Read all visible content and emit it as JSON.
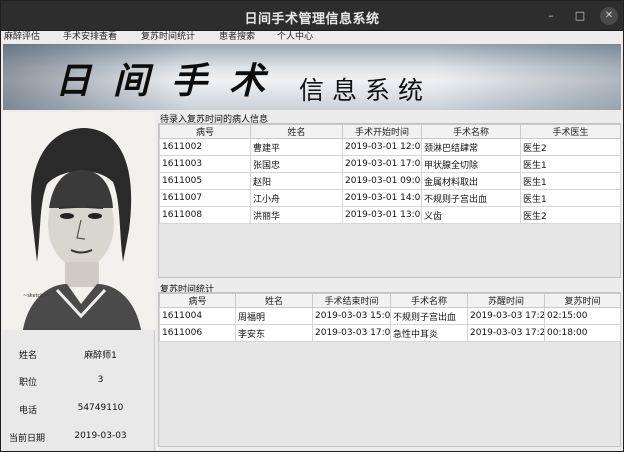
{
  "window": {
    "title": "日间手术管理信息系统"
  },
  "window_controls": {
    "minimize": "–",
    "maximize": "□",
    "close": "✕"
  },
  "menu": [
    "麻醉评估",
    "手术安排查看",
    "复苏时间统计",
    "患者搜索",
    "个人中心"
  ],
  "banner": {
    "calligraphy": "日间手术",
    "subtitle": "信息系统"
  },
  "profile": {
    "fields": [
      {
        "label": "姓名",
        "value": "麻醉师1"
      },
      {
        "label": "职位",
        "value": "3"
      },
      {
        "label": "电话",
        "value": "54749110"
      },
      {
        "label": "当前日期",
        "value": "2019-03-03"
      }
    ]
  },
  "pending": {
    "title": "待录入复苏时间的病人信息",
    "columns": [
      "病号",
      "姓名",
      "手术开始时间",
      "手术名称",
      "手术医生"
    ],
    "rows": [
      [
        "1611002",
        "曹建平",
        "2019-03-01 12:00...",
        "颈淋巴结肆常",
        "医生2"
      ],
      [
        "1611003",
        "张国忠",
        "2019-03-01 17:00...",
        "甲状腺全切除",
        "医生1"
      ],
      [
        "1611005",
        "赵阳",
        "2019-03-01 09:00...",
        "金属材料取出",
        "医生1"
      ],
      [
        "1611007",
        "江小舟",
        "2019-03-01 14:01...",
        "不规则子宫出血",
        "医生1"
      ],
      [
        "1611008",
        "洪丽华",
        "2019-03-01 13:00...",
        "义齿",
        "医生2"
      ]
    ]
  },
  "stats": {
    "title": "复苏时间统计",
    "columns": [
      "病号",
      "姓名",
      "手术结束时间",
      "手术名称",
      "苏醒时间",
      "复苏时间"
    ],
    "rows": [
      [
        "1611004",
        "周福明",
        "2019-03-03 15:05...",
        "不规则子宫出血",
        "2019-03-03 17:20...",
        "02:15:00"
      ],
      [
        "1611006",
        "李安东",
        "2019-03-03 17:02...",
        "急性中耳炎",
        "2019-03-03 17:20...",
        "00:18:00"
      ]
    ]
  }
}
